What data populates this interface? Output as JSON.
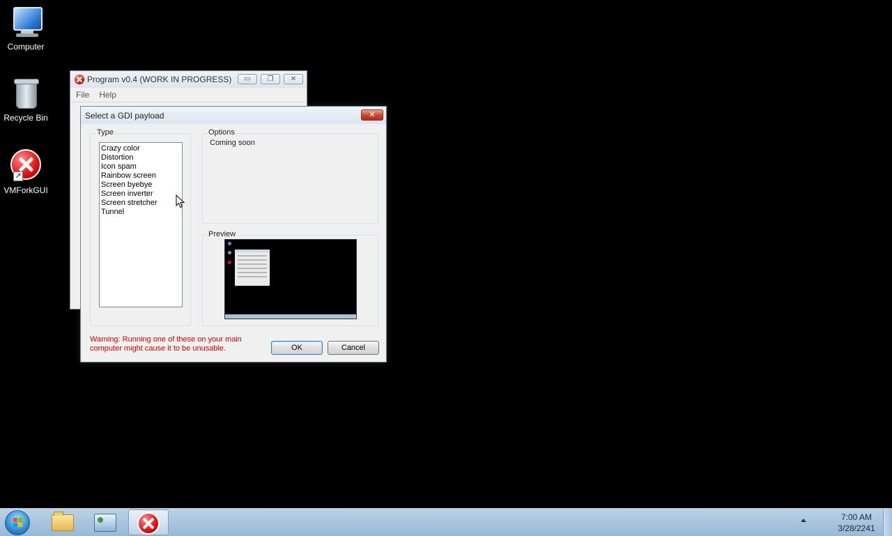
{
  "desktop": {
    "icons": [
      {
        "label": "Computer",
        "icon": "computer-icon"
      },
      {
        "label": "Recycle Bin",
        "icon": "recycle-bin-icon"
      },
      {
        "label": "VMForkGUI",
        "icon": "error-icon"
      }
    ]
  },
  "main_window": {
    "title": "Program v0.4 (WORK IN PROGRESS)",
    "menu": [
      "File",
      "Help"
    ],
    "caption_buttons": {
      "minimize": "▭",
      "restore": "❐",
      "close": "✕"
    }
  },
  "dialog": {
    "title": "Select a GDI payload",
    "close_glyph": "✕",
    "type_group_label": "Type",
    "type_items": [
      "Crazy color",
      "Distortion",
      "Icon spam",
      "Rainbow screen",
      "Screen byebye",
      "Screen inverter",
      "Screen stretcher",
      "Tunnel"
    ],
    "options_group_label": "Options",
    "options_text": "Coming soon",
    "preview_group_label": "Preview",
    "warning": "Warning: Running one of these on your main computer might cause it to be unusable.",
    "ok_label": "OK",
    "cancel_label": "Cancel"
  },
  "taskbar": {
    "pinned": [
      "start-orb",
      "explorer-icon",
      "control-panel-icon",
      "vmforkgui-icon"
    ],
    "clock_time": "7:00 AM",
    "clock_date": "3/28/2241"
  },
  "colors": {
    "warning_text": "#d40000",
    "desktop_bg": "#000000",
    "taskbar": "#a8c4dd"
  }
}
